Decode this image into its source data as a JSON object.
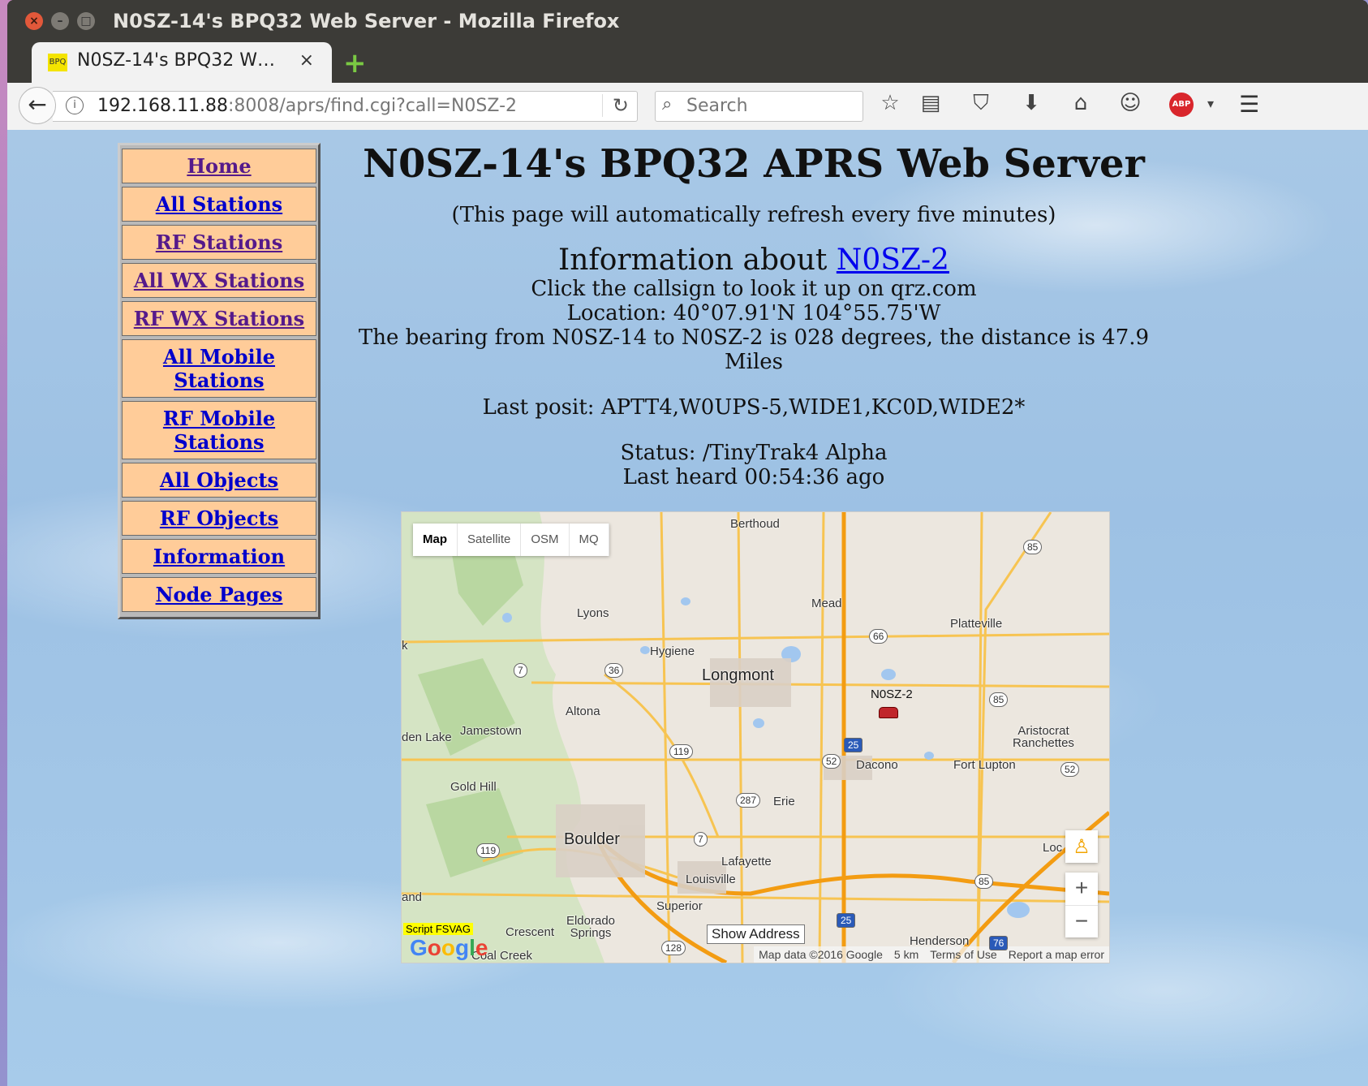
{
  "window": {
    "title": "N0SZ-14's BPQ32 Web Server - Mozilla Firefox"
  },
  "tab": {
    "title": "N0SZ-14's BPQ32 W…",
    "favicon_text": "BPQ",
    "close": "×",
    "new_tab": "+"
  },
  "navbar": {
    "url_host": "192.168.11.88",
    "url_rest": ":8008/aprs/find.cgi?call=N0SZ-2",
    "search_placeholder": "Search",
    "abp_label": "ABP"
  },
  "sidebar": {
    "items": [
      {
        "label": "Home"
      },
      {
        "label": "All Stations"
      },
      {
        "label": "RF Stations"
      },
      {
        "label": "All WX Stations"
      },
      {
        "label": "RF WX Stations"
      },
      {
        "label": "All Mobile Stations"
      },
      {
        "label": "RF Mobile Stations"
      },
      {
        "label": "All Objects"
      },
      {
        "label": "RF Objects"
      },
      {
        "label": "Information"
      },
      {
        "label": "Node Pages"
      }
    ]
  },
  "page": {
    "title": "N0SZ-14's BPQ32 APRS Web Server",
    "refresh_note": "(This page will automatically refresh every five minutes)",
    "info_prefix": "Information about",
    "callsign": "N0SZ-2",
    "qrz_note": "Click the callsign to look it up on qrz.com",
    "location": "Location: 40°07.91'N 104°55.75'W",
    "bearing": "The bearing from N0SZ-14 to N0SZ-2 is 028 degrees, the distance is 47.9 Miles",
    "last_posit": "Last posit: APTT4,W0UPS-5,WIDE1,KC0D,WIDE2*",
    "status": "Status: /TinyTrak4 Alpha",
    "last_heard": "Last heard 00:54:36 ago"
  },
  "map": {
    "types": [
      "Map",
      "Satellite",
      "OSM",
      "MQ"
    ],
    "active_type": "Map",
    "station_label": "N0SZ-2",
    "show_address": "Show Address",
    "script_badge": "Script FSVAG",
    "attribution": [
      "Map data ©2016 Google",
      "5 km",
      "Terms of Use",
      "Report a map error"
    ],
    "zoom_in": "+",
    "zoom_out": "−",
    "places": [
      "Berthoud",
      "Mead",
      "Platteville",
      "Lyons",
      "Hygiene",
      "Longmont",
      "Altona",
      "Jamestown",
      "den Lake",
      "Aristocrat Ranchettes",
      "Dacono",
      "Fort Lupton",
      "Gold Hill",
      "Erie",
      "Boulder",
      "Lafayette",
      "Louisville",
      "Superior",
      "Eldorado Springs",
      "Crescent",
      "Coal Creek",
      "Henderson",
      "Loc",
      "and",
      "k"
    ],
    "road_shields": [
      "85",
      "66",
      "36",
      "7",
      "119",
      "25",
      "52",
      "287",
      "7",
      "119",
      "85",
      "25",
      "128",
      "85",
      "52",
      "76"
    ]
  }
}
